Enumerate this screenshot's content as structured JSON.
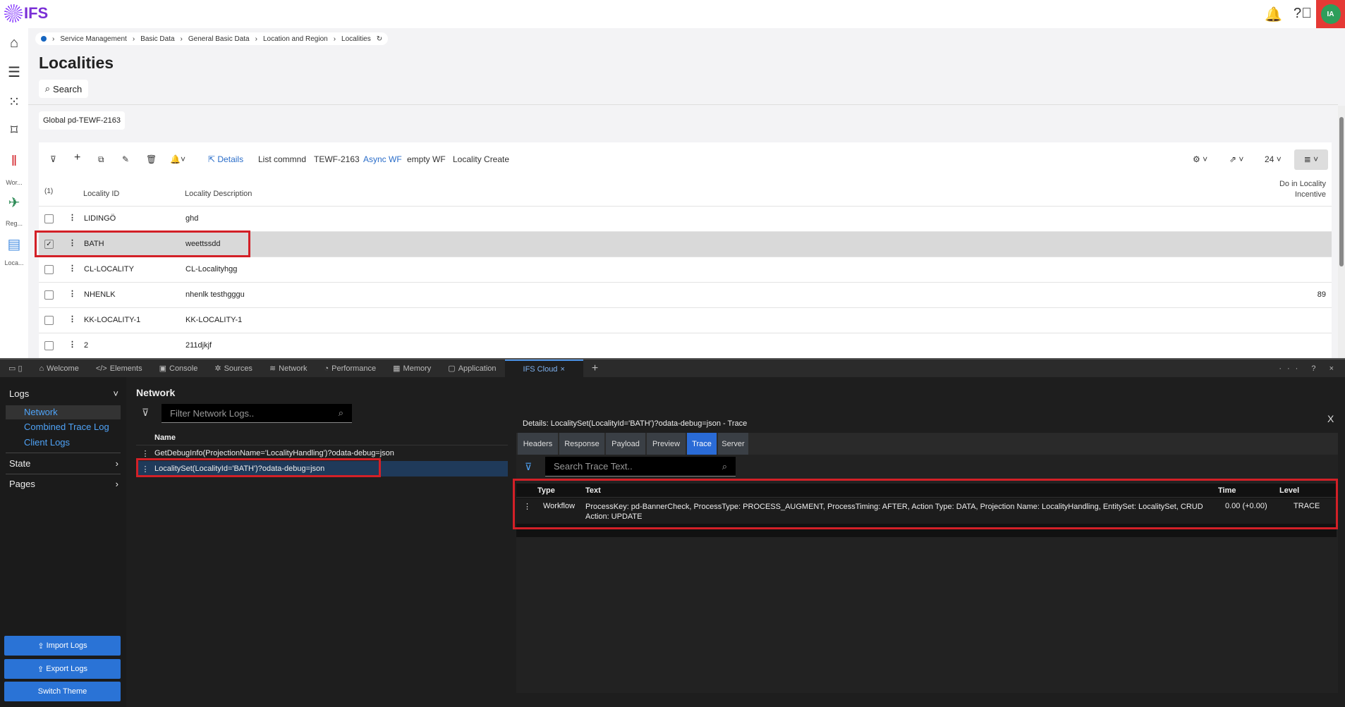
{
  "app": {
    "logo": "IFS",
    "user_initials": "IA"
  },
  "breadcrumb": [
    "Service Management",
    "Basic Data",
    "General Basic Data",
    "Location and Region",
    "Localities"
  ],
  "page": {
    "title": "Localities",
    "search_label": "Search",
    "context_chip": "Global pd-TEWF-2163"
  },
  "nav": {
    "items": [
      "Wor...",
      "Reg...",
      "Loca..."
    ]
  },
  "toolbar": {
    "details": "Details",
    "commands": [
      "List commnd",
      "TEWF-2163",
      "Async WF",
      "empty WF",
      "Locality Create"
    ],
    "page_size": "24"
  },
  "table": {
    "selected_count": "(1)",
    "columns": [
      "Locality ID",
      "Locality Description",
      "Do in Locality Incentive"
    ],
    "rows": [
      {
        "id": "LIDINGÖ",
        "desc": "ghd",
        "incentive": "",
        "selected": false
      },
      {
        "id": "BATH",
        "desc": "weettssdd",
        "incentive": "",
        "selected": true
      },
      {
        "id": "CL-LOCALITY",
        "desc": "CL-Localityhgg",
        "incentive": "",
        "selected": false
      },
      {
        "id": "NHENLK",
        "desc": "nhenlk testhgggu",
        "incentive": "89",
        "selected": false
      },
      {
        "id": "KK-LOCALITY-1",
        "desc": "KK-LOCALITY-1",
        "incentive": "",
        "selected": false
      },
      {
        "id": "2",
        "desc": "211djkjf",
        "incentive": "",
        "selected": false
      }
    ]
  },
  "devtools": {
    "tabs": [
      "Welcome",
      "Elements",
      "Console",
      "Sources",
      "Network",
      "Performance",
      "Memory",
      "Application",
      "IFS Cloud"
    ],
    "sidebar": {
      "logs": "Logs",
      "items": [
        "Network",
        "Combined Trace Log",
        "Client Logs"
      ],
      "state": "State",
      "pages": "Pages",
      "buttons": [
        "Import Logs",
        "Export Logs",
        "Switch Theme"
      ]
    },
    "network": {
      "title": "Network",
      "filter_placeholder": "Filter Network Logs..",
      "name_header": "Name",
      "requests": [
        "GetDebugInfo(ProjectionName='LocalityHandling')?odata-debug=json",
        "LocalitySet(LocalityId='BATH')?odata-debug=json"
      ]
    },
    "details": {
      "title": "Details: LocalitySet(LocalityId='BATH')?odata-debug=json - Trace",
      "close": "X",
      "tabs": [
        "Headers",
        "Response",
        "Payload",
        "Preview",
        "Trace",
        "Server"
      ],
      "search_placeholder": "Search Trace Text..",
      "columns": [
        "Type",
        "Text",
        "Time",
        "Level"
      ],
      "rows": [
        {
          "type": "Workflow",
          "text": "ProcessKey: pd-BannerCheck, ProcessType: PROCESS_AUGMENT, ProcessTiming: AFTER, Action Type: DATA, Projection Name: LocalityHandling, EntitySet: LocalitySet, CRUD Action: UPDATE",
          "time": "0.00 (+0.00)",
          "level": "TRACE"
        }
      ]
    }
  }
}
